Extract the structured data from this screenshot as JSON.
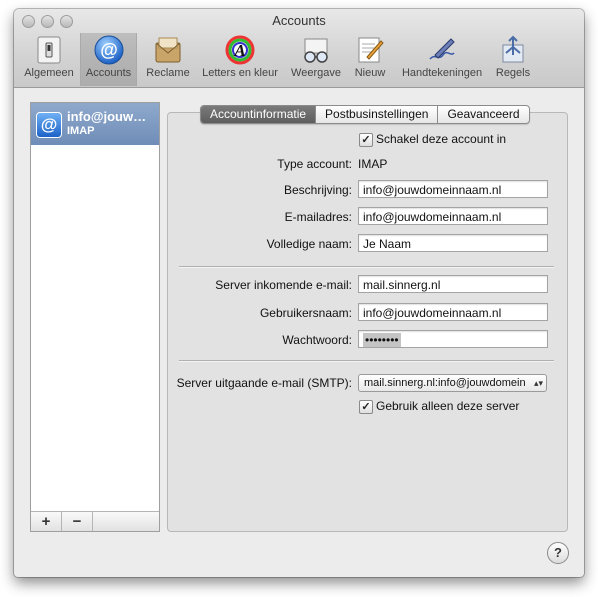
{
  "window": {
    "title": "Accounts"
  },
  "toolbar": {
    "items": [
      {
        "label": "Algemeen",
        "icon": "switch-icon"
      },
      {
        "label": "Accounts",
        "icon": "at-sign-icon"
      },
      {
        "label": "Reclame",
        "icon": "junk-mail-icon"
      },
      {
        "label": "Letters en kleur",
        "icon": "fonts-colors-icon"
      },
      {
        "label": "Weergave",
        "icon": "viewing-glasses-icon"
      },
      {
        "label": "Nieuw",
        "icon": "compose-icon"
      },
      {
        "label": "Handtekeningen",
        "icon": "signature-pen-icon"
      },
      {
        "label": "Regels",
        "icon": "rules-icon"
      }
    ],
    "selected": "Accounts"
  },
  "sidebar": {
    "account": {
      "name": "info@jouw…",
      "type": "IMAP",
      "icon": "at-sign-icon"
    },
    "add_label": "+",
    "remove_label": "−"
  },
  "tabs": [
    "Accountinformatie",
    "Postbusinstellingen",
    "Geavanceerd"
  ],
  "form": {
    "enable_checkbox": "Schakel deze account in",
    "account_type_label": "Type account:",
    "account_type_value": "IMAP",
    "description_label": "Beschrijving:",
    "description_value": "info@jouwdomeinnaam.nl",
    "email_label": "E-mailadres:",
    "email_value": "info@jouwdomeinnaam.nl",
    "fullname_label": "Volledige naam:",
    "fullname_value": "Je Naam",
    "incoming_label": "Server inkomende e-mail:",
    "incoming_value": "mail.sinnerg.nl",
    "username_label": "Gebruikersnaam:",
    "username_value": "info@jouwdomeinnaam.nl",
    "password_label": "Wachtwoord:",
    "password_value": "••••••••",
    "smtp_label": "Server uitgaande e-mail (SMTP):",
    "smtp_value": "mail.sinnerg.nl:info@jouwdomein",
    "only_server_checkbox": "Gebruik alleen deze server"
  },
  "help": "?"
}
